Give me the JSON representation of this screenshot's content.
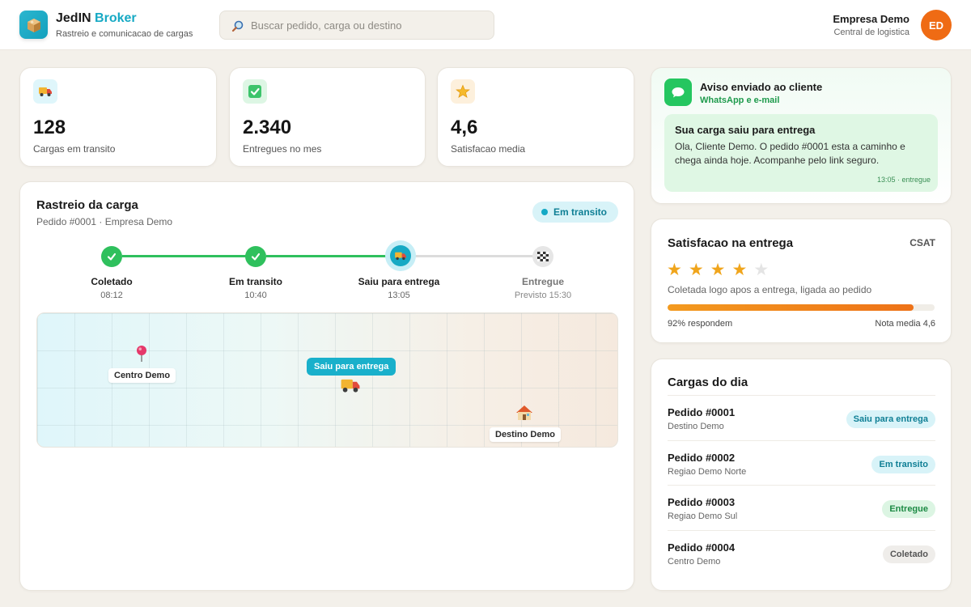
{
  "header": {
    "brand_part1": "JedIN",
    "brand_part2": "Broker",
    "brand_sub": "Rastreio e comunicacao de cargas",
    "search_placeholder": "Buscar pedido, carga ou destino",
    "company_name": "Empresa Demo",
    "company_sub": "Central de logistica",
    "avatar_initials": "ED"
  },
  "stats": [
    {
      "icon": "truck-icon",
      "value": "128",
      "label": "Cargas em transito",
      "color": "#dff6fb"
    },
    {
      "icon": "check-icon",
      "value": "2.340",
      "label": "Entregues no mes",
      "color": "#ddf6e4"
    },
    {
      "icon": "star-icon",
      "value": "4,6",
      "label": "Satisfacao media",
      "color": "#fdf0dc"
    }
  ],
  "tracking": {
    "title": "Rastreio da carga",
    "subtitle": "Pedido #0001 · Empresa Demo",
    "status": "Em transito",
    "steps": [
      {
        "label": "Coletado",
        "time": "08:12",
        "state": "done"
      },
      {
        "label": "Em transito",
        "time": "10:40",
        "state": "done"
      },
      {
        "label": "Saiu para entrega",
        "time": "13:05",
        "state": "current"
      },
      {
        "label": "Entregue",
        "time": "Previsto 15:30",
        "state": "pending"
      }
    ],
    "map": {
      "origin_label": "Centro Demo",
      "vehicle_label": "Saiu para entrega",
      "destination_label": "Destino Demo"
    }
  },
  "notification": {
    "title": "Aviso enviado ao cliente",
    "channel": "WhatsApp e e-mail",
    "message_title": "Sua carga saiu para entrega",
    "message_body": "Ola, Cliente Demo. O pedido #0001 esta a caminho e chega ainda hoje. Acompanhe pelo link seguro.",
    "message_time": "13:05 · entregue"
  },
  "satisfaction": {
    "title": "Satisfacao na entrega",
    "tag": "CSAT",
    "rating": 4,
    "max_rating": 5,
    "description": "Coletada logo apos a entrega, ligada ao pedido",
    "response_rate": 0.92,
    "response_text": "92% respondem",
    "average_text": "Nota media 4,6"
  },
  "loads": {
    "title": "Cargas do dia",
    "items": [
      {
        "id": "Pedido #0001",
        "destination": "Destino Demo",
        "status": "Saiu para entrega",
        "bg": "#d8f3f8",
        "fg": "#0f7f95"
      },
      {
        "id": "Pedido #0002",
        "destination": "Regiao Demo Norte",
        "status": "Em transito",
        "bg": "#d8f3f8",
        "fg": "#0f7f95"
      },
      {
        "id": "Pedido #0003",
        "destination": "Regiao Demo Sul",
        "status": "Entregue",
        "bg": "#dcf5e3",
        "fg": "#1c8a44"
      },
      {
        "id": "Pedido #0004",
        "destination": "Centro Demo",
        "status": "Coletado",
        "bg": "#efedea",
        "fg": "#555555"
      }
    ]
  },
  "colors": {
    "accent": "#16a9c4",
    "success": "#22c05c",
    "orange": "#ef6b14",
    "star": "#f0a51c"
  }
}
